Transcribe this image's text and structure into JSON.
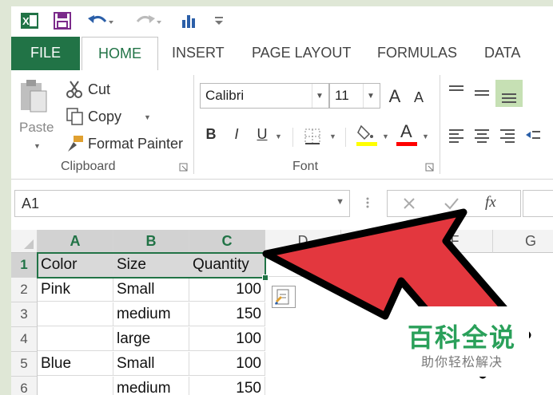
{
  "tabs": [
    "FILE",
    "HOME",
    "INSERT",
    "PAGE LAYOUT",
    "FORMULAS",
    "DATA"
  ],
  "clipboard": {
    "paste_label": "Paste",
    "cut_label": "Cut",
    "copy_label": "Copy",
    "format_painter_label": "Format Painter",
    "group_label": "Clipboard"
  },
  "font": {
    "font_name": "Calibri",
    "font_size": "11",
    "group_label": "Font",
    "bold": "B",
    "italic": "I",
    "underline": "U",
    "grow": "A",
    "shrink": "A",
    "color_a": "A",
    "fill_color": "#ffff00",
    "font_color": "#ff0000"
  },
  "formula_bar": {
    "name_box": "A1",
    "fx": "fx"
  },
  "grid": {
    "columns": [
      "A",
      "B",
      "C",
      "D",
      "",
      "F",
      "G"
    ],
    "rows": [
      {
        "num": "1",
        "cells": [
          "Color",
          "Size",
          "Quantity"
        ]
      },
      {
        "num": "2",
        "cells": [
          "Pink",
          "Small",
          "100"
        ]
      },
      {
        "num": "3",
        "cells": [
          "",
          "medium",
          "150"
        ]
      },
      {
        "num": "4",
        "cells": [
          "",
          "large",
          "100"
        ]
      },
      {
        "num": "5",
        "cells": [
          "Blue",
          "Small",
          "100"
        ]
      },
      {
        "num": "6",
        "cells": [
          "",
          "medium",
          "150"
        ]
      }
    ]
  },
  "watermark": {
    "title": "百科全说",
    "subtitle": "助你轻松解决"
  },
  "colors": {
    "excel_green": "#217346",
    "arrow_red": "#e3373e",
    "arrow_outline": "#000000"
  }
}
